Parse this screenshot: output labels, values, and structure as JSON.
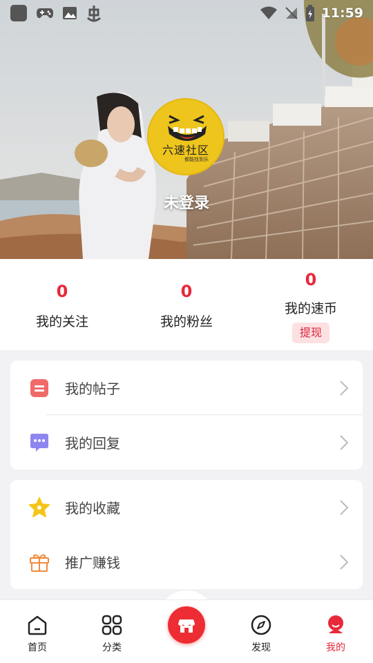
{
  "statusbar": {
    "time": "11:59"
  },
  "profile": {
    "avatar_text": "六速社区",
    "avatar_subtext": "都能找到乐",
    "username": "未登录"
  },
  "stats": [
    {
      "value": "0",
      "label": "我的关注"
    },
    {
      "value": "0",
      "label": "我的粉丝"
    },
    {
      "value": "0",
      "label": "我的速币",
      "action": "提现"
    }
  ],
  "menu_group_1": [
    {
      "label": "我的帖子",
      "icon": "post-icon"
    },
    {
      "label": "我的回复",
      "icon": "reply-icon"
    }
  ],
  "menu_group_2": [
    {
      "label": "我的收藏",
      "icon": "star-icon"
    },
    {
      "label": "推广赚钱",
      "icon": "gift-icon"
    }
  ],
  "nav": [
    {
      "label": "首页",
      "icon": "home-icon"
    },
    {
      "label": "分类",
      "icon": "grid-icon"
    },
    {
      "label": "",
      "icon": "shop-icon"
    },
    {
      "label": "发现",
      "icon": "compass-icon"
    },
    {
      "label": "我的",
      "icon": "profile-icon"
    }
  ],
  "colors": {
    "accent": "#e8293a",
    "avatar": "#eec51d",
    "withdraw_bg": "#fde0e2"
  }
}
